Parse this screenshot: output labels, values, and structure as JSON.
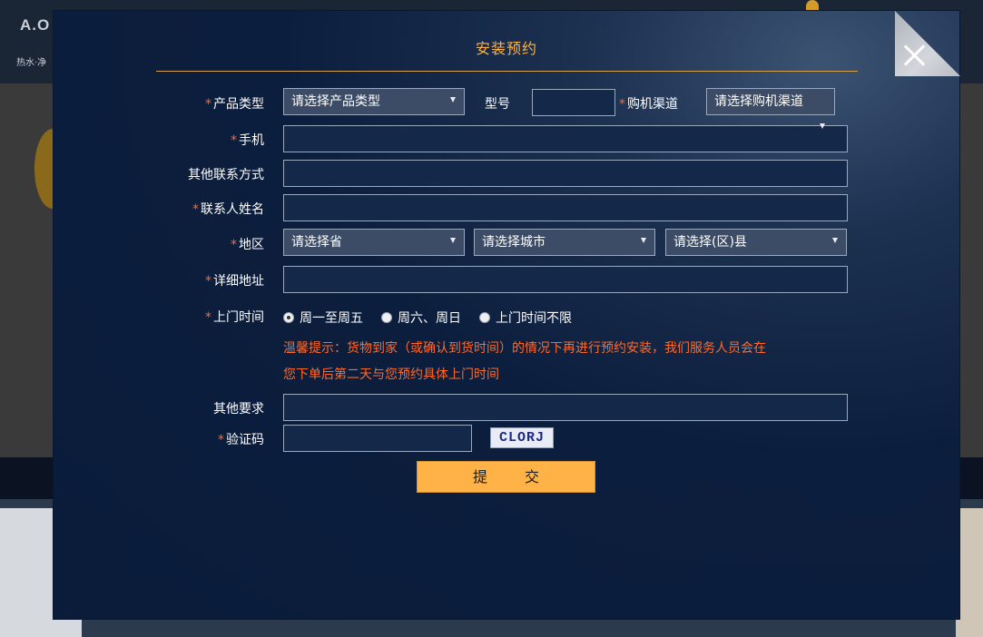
{
  "background": {
    "logo_text": "A.O",
    "logo_sub": "热水·净"
  },
  "modal": {
    "title": "安装预约",
    "close_icon": "close-icon"
  },
  "form": {
    "required_mark": "*",
    "product_type_label": "产品类型",
    "product_type_value": "请选择产品类型",
    "model_label": "型号",
    "model_value": "",
    "channel_label": "购机渠道",
    "channel_value": "请选择购机渠道",
    "phone_label": "手机",
    "phone_value": "",
    "other_contact_label": "其他联系方式",
    "other_contact_value": "",
    "contact_name_label": "联系人姓名",
    "contact_name_value": "",
    "region_label": "地区",
    "province_value": "请选择省",
    "city_value": "请选择城市",
    "district_value": "请选择(区)县",
    "address_label": "详细地址",
    "address_value": "",
    "visit_time_label": "上门时间",
    "visit_options": [
      "周一至周五",
      "周六、周日",
      "上门时间不限"
    ],
    "visit_selected": 0,
    "tip_line1": "温馨提示：货物到家（或确认到货时间）的情况下再进行预约安装，我们服务人员会在",
    "tip_line2": "您下单后第二天与您预约具体上门时间",
    "other_req_label": "其他要求",
    "other_req_value": "",
    "captcha_label": "验证码",
    "captcha_value": "",
    "captcha_image_text": "CLORJ",
    "submit_label": "提 交"
  },
  "colors": {
    "accent": "#ffb347",
    "required": "#ff6a2a",
    "modal_bg": "#0a1c3a"
  }
}
